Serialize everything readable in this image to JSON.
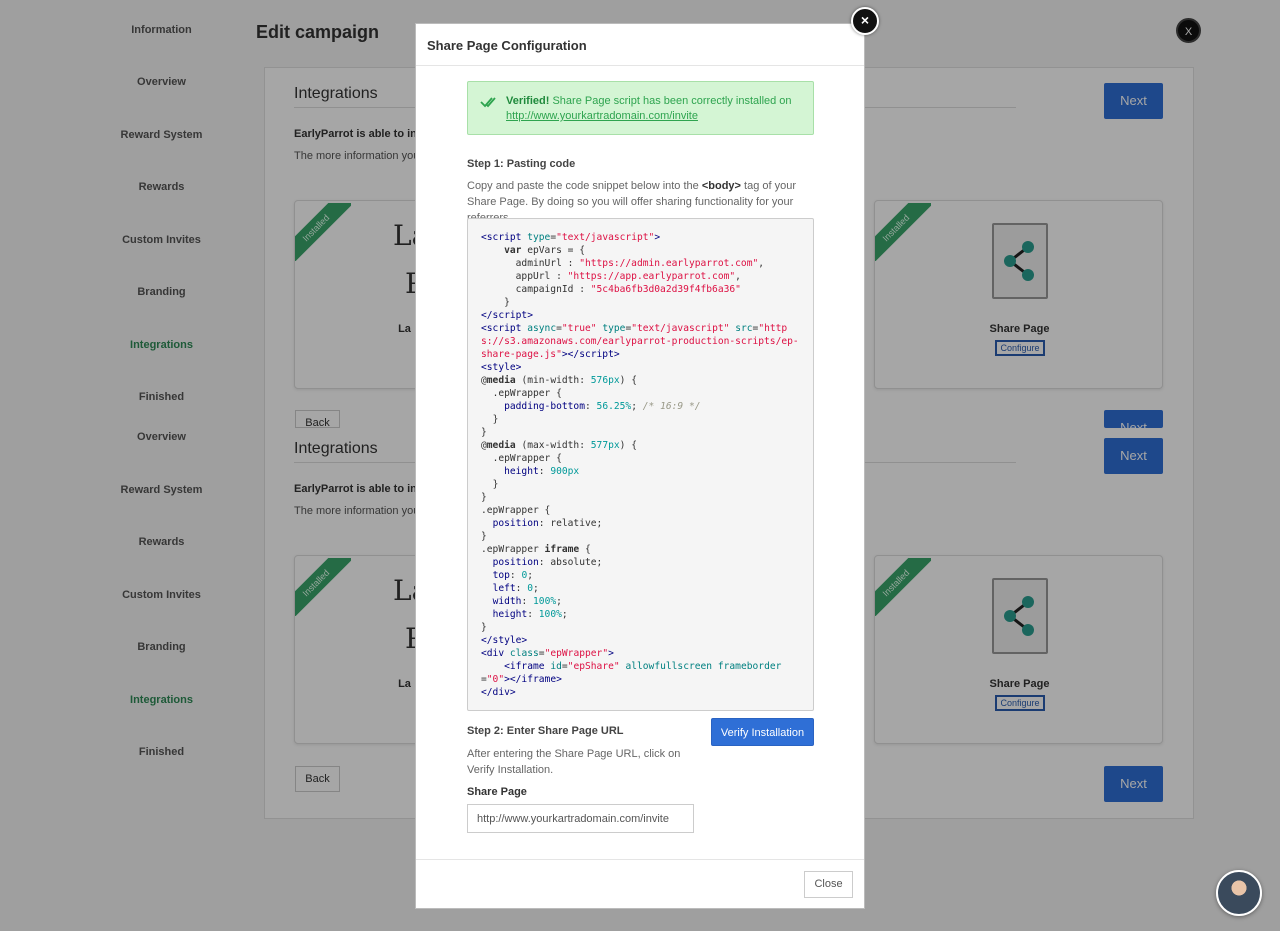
{
  "page": {
    "title": "Edit campaign",
    "close_label": "X"
  },
  "sidebar": {
    "items": [
      {
        "label": "Information"
      },
      {
        "label": "Overview"
      },
      {
        "label": "Reward System"
      },
      {
        "label": "Rewards"
      },
      {
        "label": "Custom Invites"
      },
      {
        "label": "Branding"
      },
      {
        "label": "Integrations",
        "active": true
      },
      {
        "label": "Finished"
      }
    ],
    "items_repeat": [
      {
        "label": "Overview"
      },
      {
        "label": "Reward System"
      },
      {
        "label": "Rewards"
      },
      {
        "label": "Custom Invites"
      },
      {
        "label": "Branding"
      },
      {
        "label": "Integrations",
        "active": true
      },
      {
        "label": "Finished"
      }
    ]
  },
  "integrations": {
    "title": "Integrations",
    "bold_text": "EarlyParrot is able to in",
    "desc_text": "The more information you",
    "installed_badge": "Installed",
    "left_card_text": "La",
    "left_card_text2": "P",
    "left_card_label": "La",
    "share_card_label": "Share Page",
    "configure_label": "Configure",
    "next_label": "Next",
    "back_label": "Back"
  },
  "modal": {
    "title": "Share Page Configuration",
    "close_icon": "×",
    "alert": {
      "strong": "Verified!",
      "text": " Share Page script has been correctly installed on",
      "link": "http://www.yourkartradomain.com/invite"
    },
    "step1": {
      "title": "Step 1: Pasting code",
      "desc_pre": "Copy and paste the code snippet below into the ",
      "desc_tag": "<body>",
      "desc_post": " tag of your Share Page. By doing so you will offer sharing functionality for your referrers."
    },
    "code": {
      "admin_url": "\"https://admin.earlyparrot.com\"",
      "app_url": "\"https://app.earlyparrot.com\"",
      "campaign_id": "\"5c4ba6fb3d0a2d39f4fb6a36\"",
      "script_src": "\"https://s3.amazonaws.com/earlyparrot-production-scripts/ep-share-page.js\""
    },
    "step2": {
      "title": "Step 2: Enter Share Page URL",
      "desc": "After entering the Share Page URL, click on Verify Installation.",
      "verify_label": "Verify Installation",
      "field_label": "Share Page",
      "field_value": "http://www.yourkartradomain.com/invite"
    },
    "footer_close": "Close"
  },
  "colors": {
    "primary": "#2f6fd6",
    "success": "#2ea44f",
    "ribbon": "#3aa56b"
  }
}
